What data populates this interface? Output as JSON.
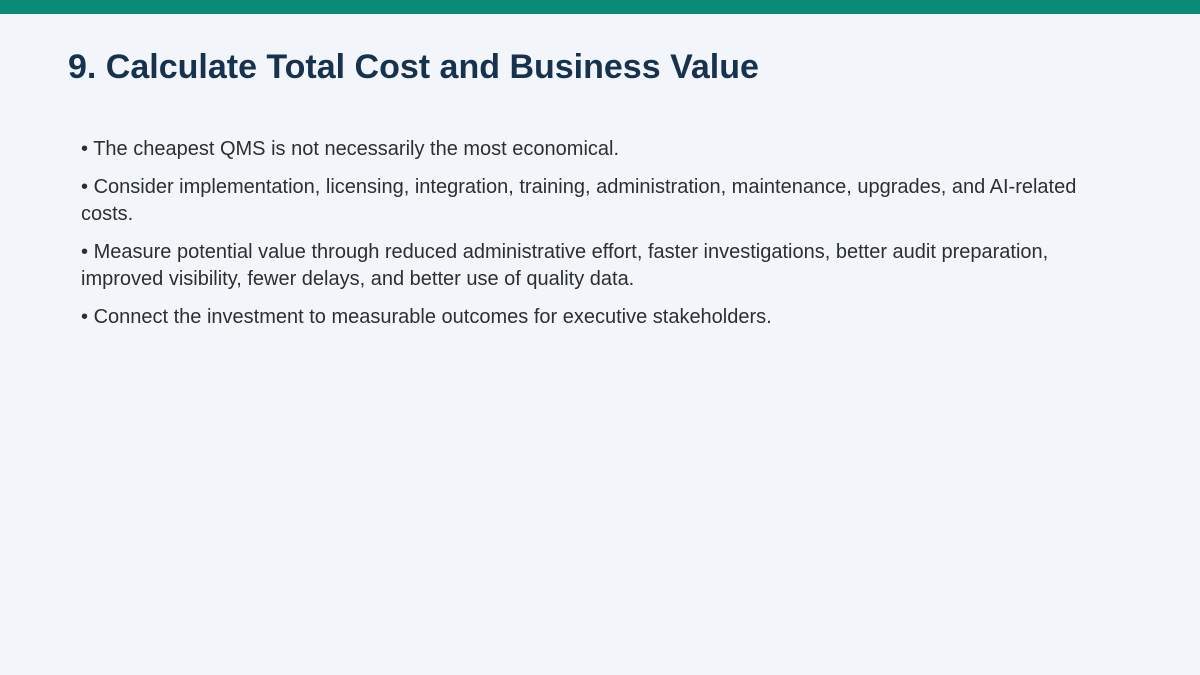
{
  "slide": {
    "title": "9. Calculate Total Cost and Business Value",
    "bullet_marker": "•",
    "bullets": [
      "The cheapest QMS is not necessarily the most economical.",
      "Consider implementation, licensing, integration, training, administration, maintenance, upgrades, and AI-related costs.",
      "Measure potential value through reduced administrative effort, faster investigations, better audit preparation, improved visibility, fewer delays, and better use of quality data.",
      "Connect the investment to measurable outcomes for executive stakeholders."
    ]
  },
  "colors": {
    "accent_bar": "#0c8a78",
    "background": "#f2f6fa",
    "title": "#17324f",
    "body_text": "#2b2f33"
  }
}
